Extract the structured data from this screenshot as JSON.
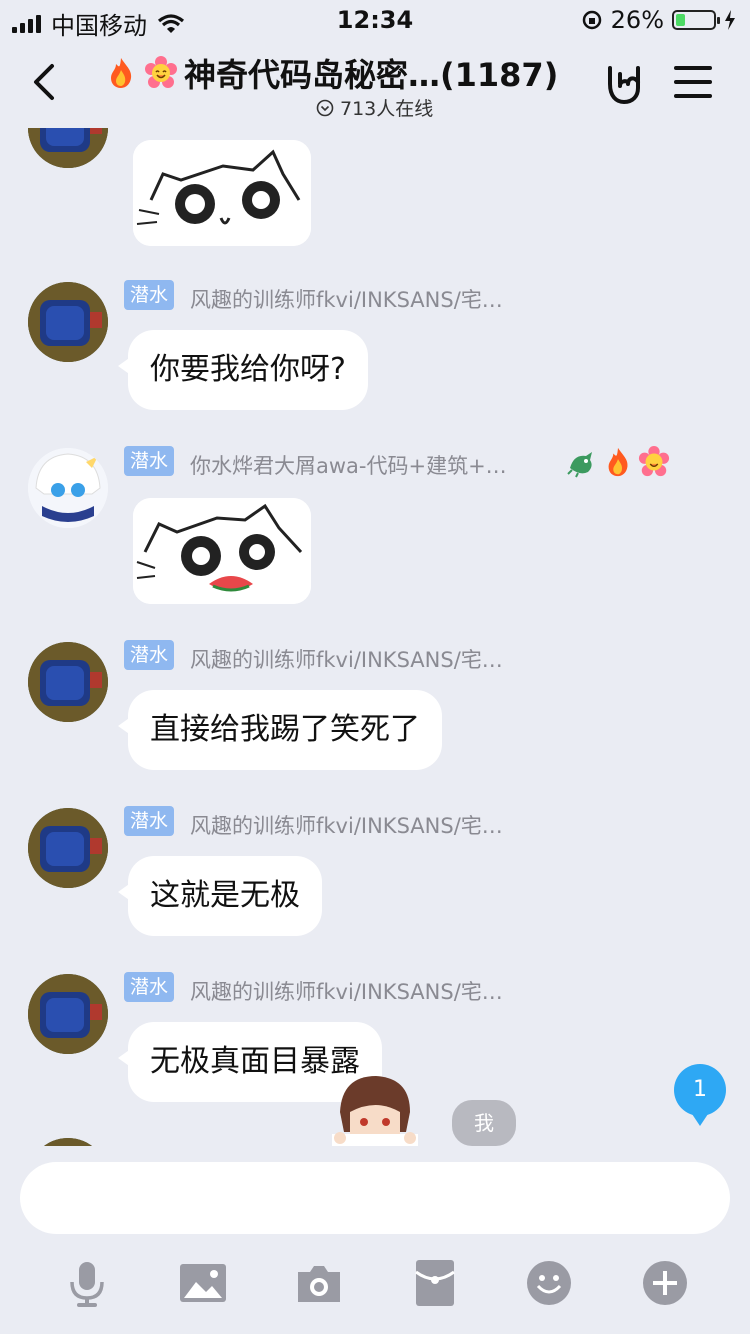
{
  "status_bar": {
    "carrier": "中国移动",
    "time": "12:34",
    "battery_percent": "26%",
    "battery_level": 0.26
  },
  "header": {
    "title": "神奇代码岛秘密…(1187)",
    "online": "713人在线",
    "icons": [
      "back-icon",
      "fire-icon",
      "flower-icon",
      "rock-hand-icon",
      "menu-icon"
    ]
  },
  "messages": [
    {
      "type": "sticker",
      "sticker_name": "cat-shocked-eyes"
    },
    {
      "tag": "潜水",
      "sender": "风趣的训练师fkvi/INKSANS/宅…",
      "text": "你要我给你呀?"
    },
    {
      "tag": "潜水",
      "sender": "你水烨君大屑awa-代码+建筑+…",
      "type": "sticker",
      "sticker_name": "cat-eating-watermelon",
      "badges": [
        "dragon-icon",
        "fire-icon",
        "flower-icon"
      ]
    },
    {
      "tag": "潜水",
      "sender": "风趣的训练师fkvi/INKSANS/宅…",
      "text": "直接给我踢了笑死了"
    },
    {
      "tag": "潜水",
      "sender": "风趣的训练师fkvi/INKSANS/宅…",
      "text": "这就是无极"
    },
    {
      "tag": "潜水",
      "sender": "风趣的训练师fkvi/INKSANS/宅…",
      "text": "无极真面目暴露"
    }
  ],
  "unread_count": "1",
  "me_label": "我",
  "input": {
    "placeholder": ""
  },
  "toolbar": [
    "microphone-icon",
    "image-icon",
    "camera-icon",
    "red-packet-icon",
    "emoji-icon",
    "plus-icon"
  ],
  "colors": {
    "background": "#eaecf3",
    "tag": "#8fb8f0",
    "unread": "#2ea8f4",
    "battery": "#4cd964"
  }
}
